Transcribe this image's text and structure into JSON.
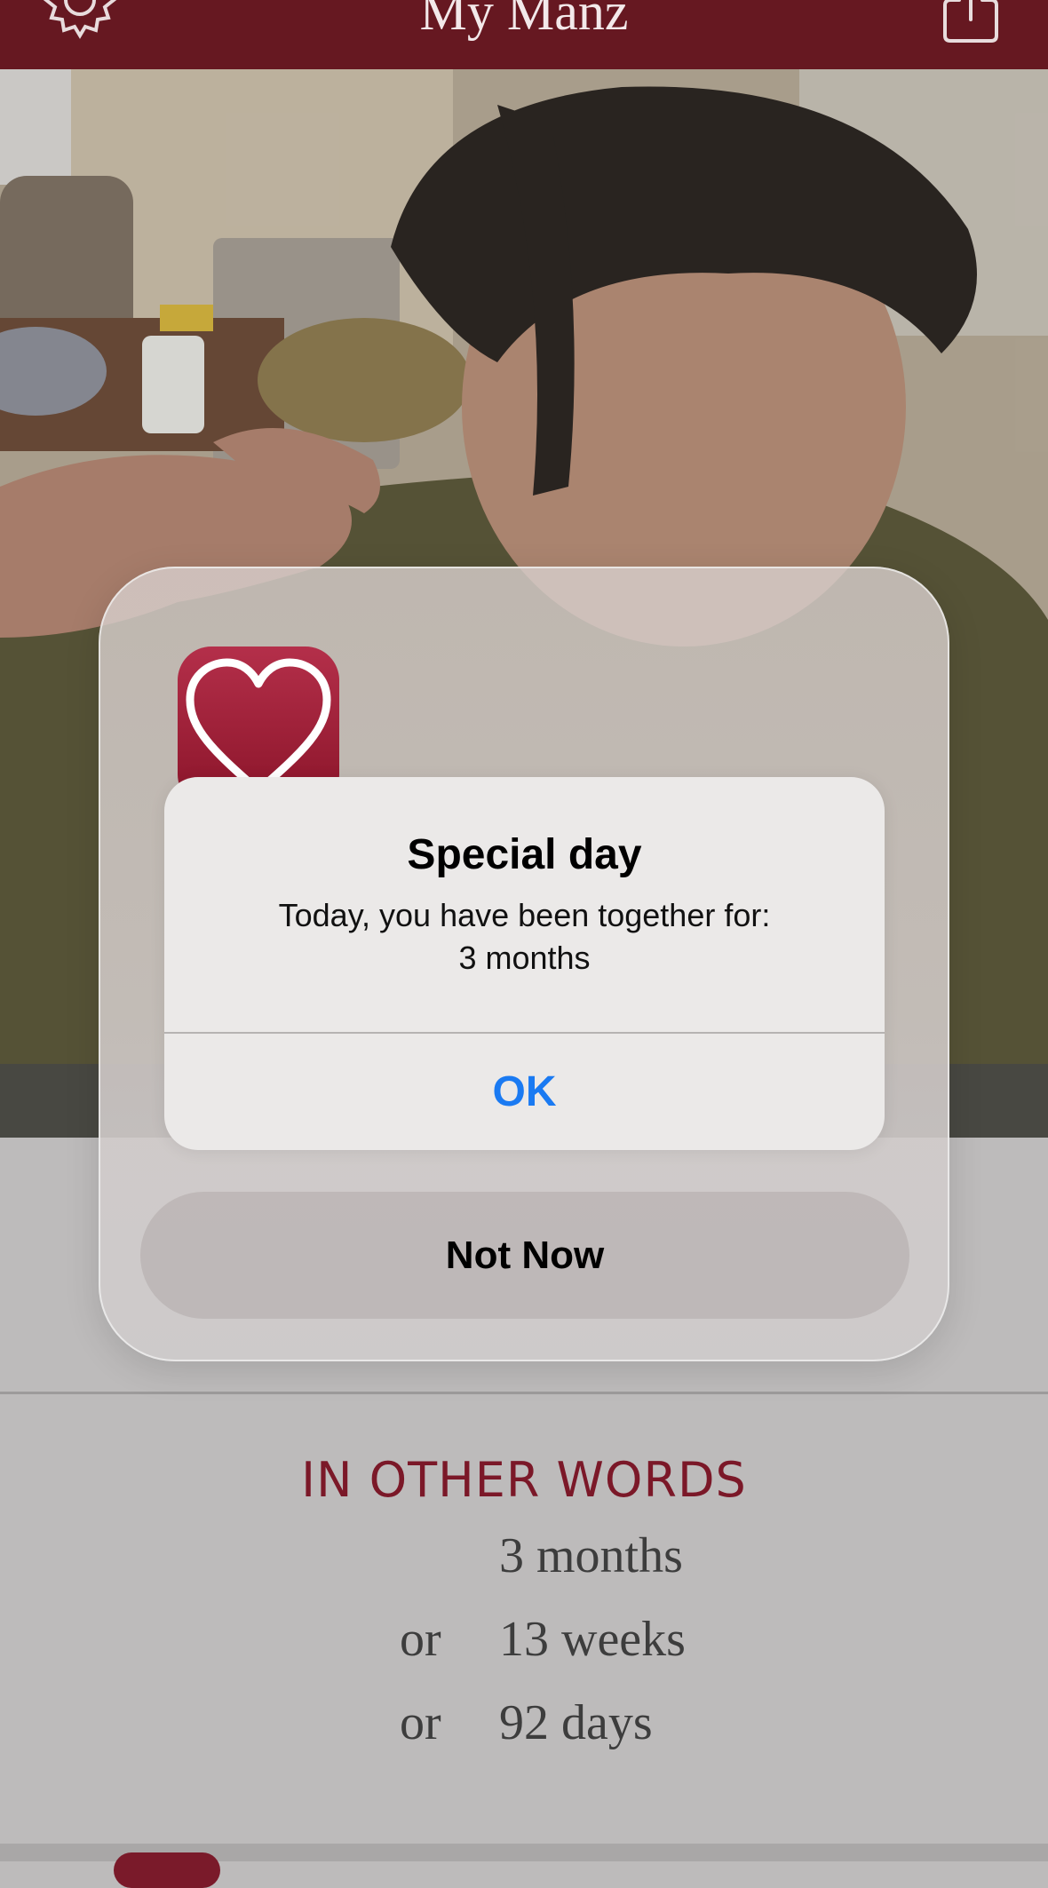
{
  "header": {
    "title": "My Manz",
    "settings_icon": "gear-icon",
    "share_icon": "share-icon",
    "background_color": "#661821"
  },
  "photo": {
    "subject": "profile-photo"
  },
  "permission_card": {
    "app_icon": "heart-icon",
    "not_now_label": "Not Now"
  },
  "alert": {
    "title": "Special day",
    "message_line1": "Today, you have been together for:",
    "message_line2": "3 months",
    "ok_label": "OK",
    "accent_color": "#1a7af2"
  },
  "summary": {
    "heading": "IN OTHER WORDS",
    "heading_color": "#7b1828",
    "rows": [
      {
        "prefix": "",
        "value": "3 months"
      },
      {
        "prefix": "or",
        "value": "13 weeks"
      },
      {
        "prefix": "or",
        "value": "92 days"
      }
    ]
  }
}
